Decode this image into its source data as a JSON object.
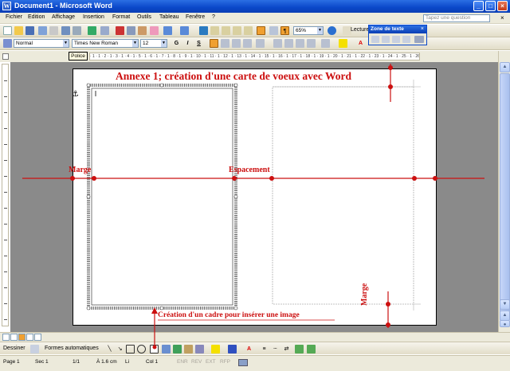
{
  "window": {
    "title": "Document1 - Microsoft Word",
    "minimize_glyph": "_",
    "maximize_glyph": "□",
    "close_glyph": "×"
  },
  "menubar": {
    "items": [
      "Fichier",
      "Edition",
      "Affichage",
      "Insertion",
      "Format",
      "Outils",
      "Tableau",
      "Fenêtre",
      "?"
    ],
    "help_placeholder": "Tapez une question",
    "mdi_close": "×"
  },
  "toolbar_standard": {
    "zoom": "65%",
    "reading_label": "Lecture"
  },
  "toolbar_format": {
    "style": "Normal",
    "font": "Times New Roman",
    "size": "12",
    "bold": "G",
    "italic": "I",
    "underline": "S"
  },
  "textbox_toolbar": {
    "title": "Zone de texte",
    "close": "×"
  },
  "ruler": {
    "tooltip": "Police",
    "scale": "· 1 · 1 · 2 · 1 · 3 · 1 · 4 · 1 · 5 · 1 · 6 · 1 · 7 · 1 · 8 · 1 · 9 · 1 · 10 · 1 · 11 · 1 · 12 · 1 · 13 · 1 · 14 · 1 · 15 · 1 · 16 · 1 · 17 · 1 · 18 · 1 · 19 · 1 · 20 · 1 · 21 · 1 · 22 · 1 · 23 · 1 · 24 · 1 · 25 · 1 · 26 · 1 · 27 ·"
  },
  "annotations": {
    "title": "Annexe 1; création d'une carte de voeux avec Word",
    "marge_left": "Marge",
    "espacement": "Espacement",
    "creation_cadre": "Création d'un cadre pour insérer une image",
    "marge_bottom": "Marge",
    "color": "#cc1010"
  },
  "drawing_toolbar": {
    "draw_label": "Dessiner",
    "shapes_label": "Formes automatiques"
  },
  "statusbar": {
    "page": "Page 1",
    "section": "Sec 1",
    "pages": "1/1",
    "position": "À 1.6 cm",
    "line": "Li",
    "column": "Col 1",
    "enr": "ENR",
    "rev": "REV",
    "ext": "EXT",
    "rfp": "RFP"
  }
}
